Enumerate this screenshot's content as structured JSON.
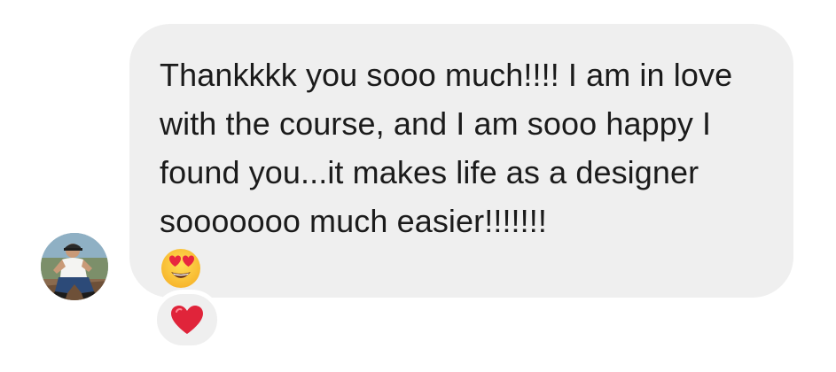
{
  "conversation": {
    "message": {
      "text": "Thankkkk you sooo much!!!! I am in love with the course, and I am sooo happy I found you...it makes life as a designer sooooooo much easier!!!!!!!",
      "emoji": "heart-eyes-emoji",
      "bubble_color": "#efefef",
      "text_color": "#1b1b1b"
    },
    "sender": {
      "avatar": "user-avatar-photo"
    },
    "reaction": {
      "icon": "red-heart-icon",
      "color": "#e0243a"
    }
  }
}
